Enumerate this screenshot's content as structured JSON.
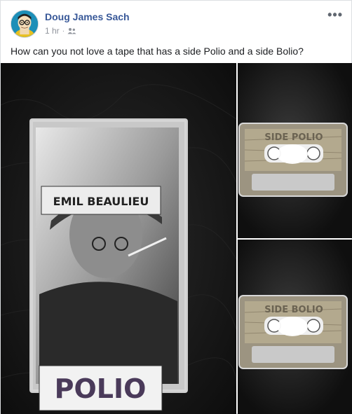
{
  "post": {
    "author": "Doug James Sach",
    "time": "1 hr",
    "separator": "·",
    "audience_icon": "friends-icon",
    "more_icon": "more-options-icon",
    "more_label": "•••",
    "text": "How can you not love a tape that has a side Polio and a side Bolio?"
  },
  "photos": {
    "main": {
      "tape_top_label": "EMIL BEAULIEU",
      "tape_bottom_label": "POLIO"
    },
    "top": {
      "cassette_label": "SIDE POLIO"
    },
    "bottom": {
      "cassette_label": "SIDE BOLIO"
    }
  },
  "colors": {
    "author_link": "#385898",
    "meta_gray": "#90949c",
    "text": "#1c1e21",
    "avatar_bg": "#1d8fb8"
  }
}
